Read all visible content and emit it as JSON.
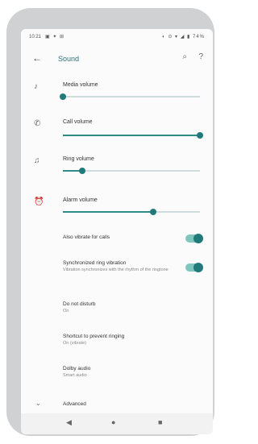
{
  "statusbar": {
    "time": "10:21",
    "left_icons": "▣ ✦ ⊞",
    "right": "◐ ⊙ ▾  ◢ ▮ 74%"
  },
  "appbar": {
    "title": "Sound"
  },
  "volumes": [
    {
      "label": "Media volume",
      "value": 0.0
    },
    {
      "label": "Call volume",
      "value": 1.0
    },
    {
      "label": "Ring volume",
      "value": 0.14
    },
    {
      "label": "Alarm volume",
      "value": 0.66
    }
  ],
  "toggles": [
    {
      "label": "Also vibrate for calls",
      "on": true
    },
    {
      "label": "Synchronized ring vibration",
      "subtitle": "Vibration synchronizes with the rhythm of the ringtone",
      "on": true
    }
  ],
  "prefs": [
    {
      "label": "Do not disturb",
      "value": "On"
    },
    {
      "label": "Shortcut to prevent ringing",
      "value": "On (vibrate)"
    },
    {
      "label": "Dolby audio",
      "value": "Smart audio"
    }
  ],
  "advanced": {
    "label": "Advanced"
  },
  "icons": {
    "back": "arrow-left-icon",
    "search": "search-icon",
    "help": "help-icon",
    "media": "music-note-icon",
    "call": "phone-icon",
    "ring": "bell-icon",
    "alarm": "alarm-clock-icon",
    "expand": "chevron-down-icon"
  },
  "colors": {
    "accent": "#1f7a79",
    "title": "#2d6f7a"
  }
}
